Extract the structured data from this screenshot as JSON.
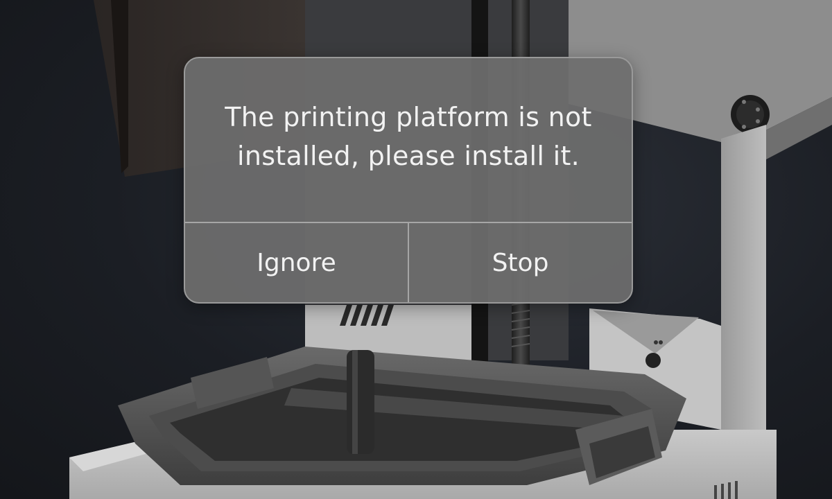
{
  "dialog": {
    "message": "The printing platform is not installed, please install it.",
    "buttons": {
      "ignore_label": "Ignore",
      "stop_label": "Stop"
    }
  },
  "colors": {
    "dialog_background": "#6e6e6e",
    "dialog_border": "#9a9a9a",
    "text": "#f2f2f2",
    "backdrop": "#1b1e24"
  }
}
